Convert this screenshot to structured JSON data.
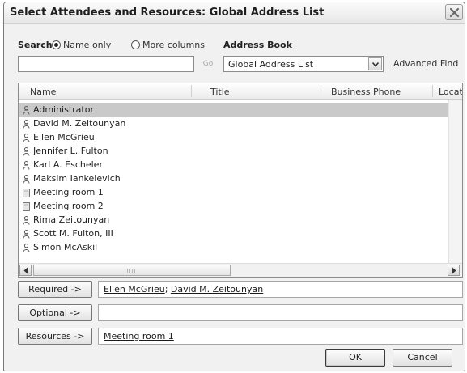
{
  "dialog": {
    "title": "Select Attendees and Resources: Global Address List"
  },
  "search": {
    "label": "Search:",
    "options": [
      {
        "label": "Name only",
        "selected": true
      },
      {
        "label": "More columns",
        "selected": false
      }
    ],
    "value": "",
    "go_label": "Go"
  },
  "address_book": {
    "label": "Address Book",
    "selected": "Global Address List",
    "advanced_find": "Advanced Find"
  },
  "list": {
    "columns": [
      "Name",
      "Title",
      "Business Phone",
      "Locatio"
    ],
    "rows": [
      {
        "name": "Administrator",
        "icon": "person-icon",
        "selected": true
      },
      {
        "name": "David M. Zeitounyan",
        "icon": "person-icon",
        "selected": false
      },
      {
        "name": "Ellen McGrieu",
        "icon": "person-icon",
        "selected": false
      },
      {
        "name": "Jennifer L. Fulton",
        "icon": "person-icon",
        "selected": false
      },
      {
        "name": "Karl A. Escheler",
        "icon": "person-icon",
        "selected": false
      },
      {
        "name": "Maksim Iankelevich",
        "icon": "person-icon",
        "selected": false
      },
      {
        "name": "Meeting room 1",
        "icon": "room-icon",
        "selected": false
      },
      {
        "name": "Meeting room 2",
        "icon": "room-icon",
        "selected": false
      },
      {
        "name": "Rima Zeitounyan",
        "icon": "person-icon",
        "selected": false
      },
      {
        "name": "Scott M. Fulton, III",
        "icon": "person-icon",
        "selected": false
      },
      {
        "name": "Simon McAskil",
        "icon": "person-icon",
        "selected": false
      }
    ]
  },
  "pickers": {
    "required": {
      "button": "Required ->",
      "names": [
        "Ellen McGrieu",
        "David M. Zeitounyan"
      ],
      "separator": "; "
    },
    "optional": {
      "button": "Optional ->",
      "names": []
    },
    "resources": {
      "button": "Resources ->",
      "names": [
        "Meeting room 1"
      ]
    }
  },
  "buttons": {
    "ok": "OK",
    "cancel": "Cancel"
  },
  "colors": {
    "selected_row": "#c9c9c9",
    "dialog_bg": "#f1f1f1"
  }
}
